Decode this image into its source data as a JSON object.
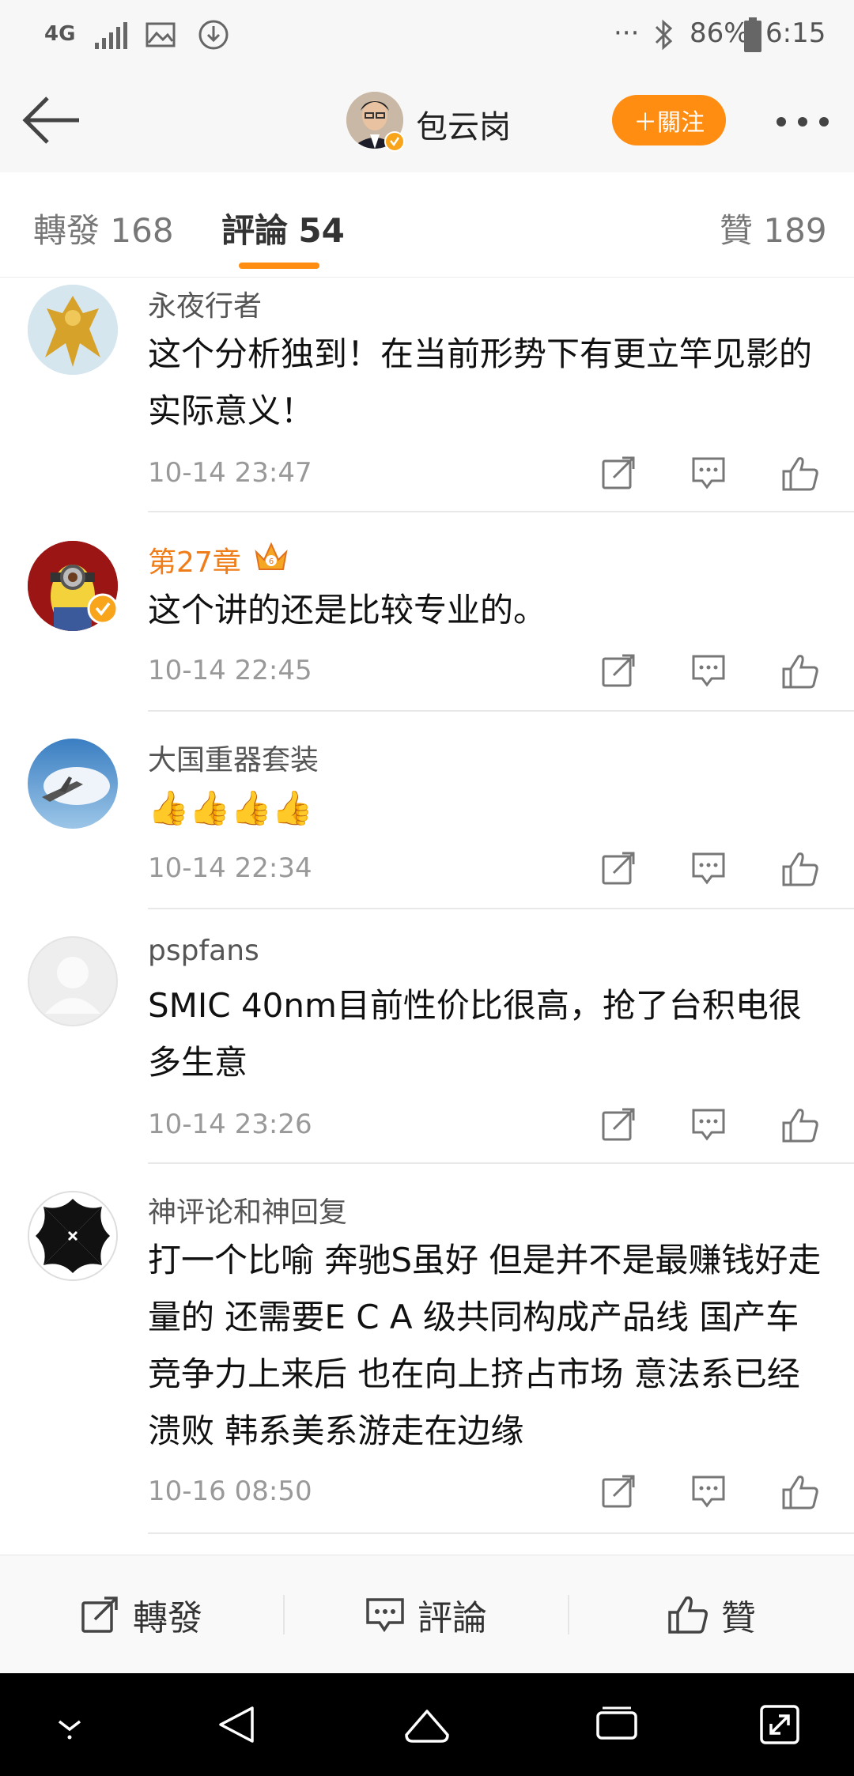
{
  "status_bar": {
    "network": "4G",
    "battery": "86%",
    "time": "6:15",
    "more": "···"
  },
  "header": {
    "profile_name": "包云岗",
    "follow_label": "＋關注"
  },
  "tabs": [
    {
      "label": "轉發",
      "count": "168"
    },
    {
      "label": "評論",
      "count": "54"
    },
    {
      "label": "贊",
      "count": "189"
    }
  ],
  "comments": [
    {
      "username": "永夜行者",
      "text": "这个分析独到！在当前形势下有更立竿见影的实际意义！",
      "time": "10-14 23:47"
    },
    {
      "username": "第27章",
      "text": "这个讲的还是比较专业的。",
      "time": "10-14 22:45",
      "username_color": "#ef7d1a"
    },
    {
      "username": "大国重器套装",
      "text": "👍👍👍👍",
      "time": "10-14 22:34"
    },
    {
      "username": "pspfans",
      "text": "SMIC 40nm目前性价比很高，抢了台积电很多生意",
      "time": "10-14 23:26"
    },
    {
      "username": "神评论和神回复",
      "text": "打一个比喻 奔驰S虽好 但是并不是最赚钱好走量的 还需要E C A 级共同构成产品线 国产车竞争力上来后 也在向上挤占市场 意法系已经溃败 韩系美系游走在边缘",
      "time": "10-16 08:50"
    }
  ],
  "toolbar": {
    "repost_label": "轉發",
    "comment_label": "評論",
    "like_label": "贊"
  },
  "colors": {
    "accent": "#ff8d12",
    "verified": "#f8a51c",
    "vip_name": "#ef7d1a"
  }
}
